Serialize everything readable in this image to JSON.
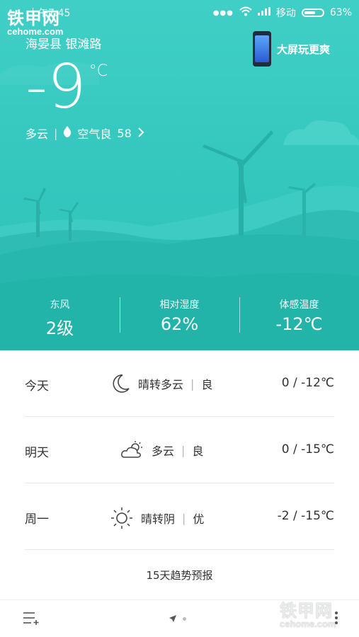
{
  "status_bar": {
    "time": "上午7:45",
    "carrier": "移动",
    "battery_percent": "63%",
    "battery_level": 0.63
  },
  "watermark": {
    "brand": "铁甲网",
    "site": "cehome.com"
  },
  "location": "海晏县 银滩路",
  "promo": "大屏玩更爽",
  "current": {
    "temp": "-9",
    "unit": "°C",
    "condition": "多云",
    "aqi_label": "空气良",
    "aqi_value": "58"
  },
  "metrics": [
    {
      "label": "东风",
      "value": "2级"
    },
    {
      "label": "相对湿度",
      "value": "62%"
    },
    {
      "label": "体感温度",
      "value": "-12℃"
    }
  ],
  "forecast": [
    {
      "day": "今天",
      "icon": "moon-icon",
      "weather": "晴转多云",
      "air": "良",
      "range": "0 / -12℃"
    },
    {
      "day": "明天",
      "icon": "partly-cloudy-icon",
      "weather": "多云",
      "air": "良",
      "range": "0 / -15℃"
    },
    {
      "day": "周一",
      "icon": "sun-icon",
      "weather": "晴转阴",
      "air": "优",
      "range": "-2 / -15℃"
    }
  ],
  "trend_link": "15天趋势预报",
  "colors": {
    "hero": "#35c8bf",
    "text_dark": "#333333",
    "divider": "#e8e8e8"
  }
}
